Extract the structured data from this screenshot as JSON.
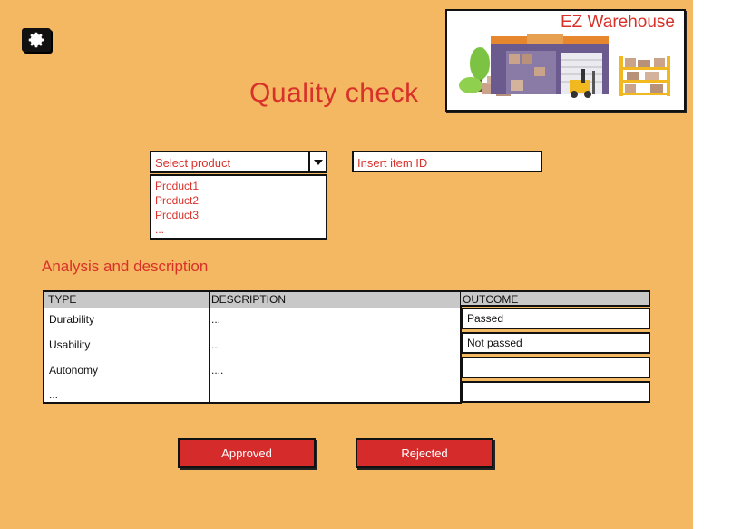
{
  "app": {
    "title": "Quality check",
    "brand": "EZ Warehouse"
  },
  "form": {
    "product_select_placeholder": "Select product",
    "product_options": [
      "Product1",
      "Product2",
      "Product3",
      "..."
    ],
    "item_id_placeholder": "Insert  item ID"
  },
  "analysis": {
    "section_title": "Analysis and description",
    "headers": {
      "type": "TYPE",
      "description": "DESCRIPTION",
      "outcome": "OUTCOME"
    },
    "rows": [
      {
        "type": "Durability",
        "description": "...",
        "outcome": "Passed"
      },
      {
        "type": "Usability",
        "description": "...",
        "outcome": "Not passed"
      },
      {
        "type": "Autonomy",
        "description": "....",
        "outcome": ""
      },
      {
        "type": "...",
        "description": "",
        "outcome": ""
      }
    ]
  },
  "actions": {
    "approve_label": "Approved",
    "reject_label": "Rejected"
  },
  "colors": {
    "background": "#f4b862",
    "accent": "#d8312a",
    "button": "#d62b2b"
  }
}
